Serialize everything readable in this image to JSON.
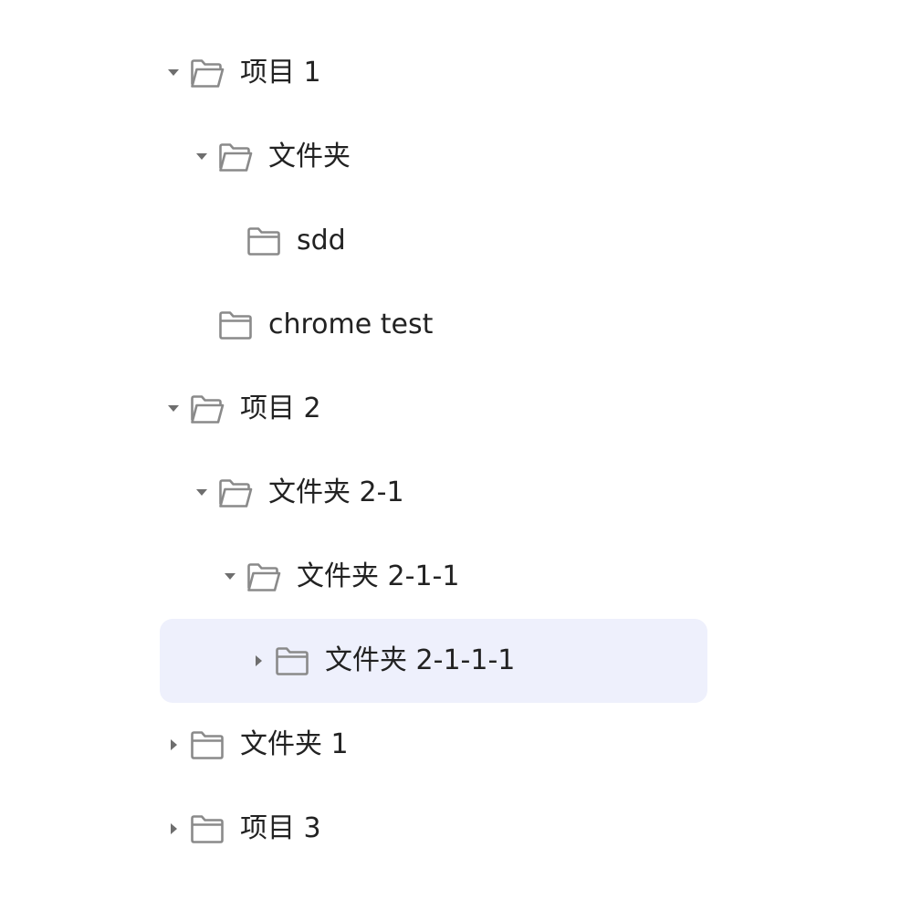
{
  "tree": {
    "nodes": [
      {
        "label": "项目 1",
        "level": 0,
        "expanded": true,
        "has_children": true,
        "selected": false
      },
      {
        "label": "文件夹",
        "level": 1,
        "expanded": true,
        "has_children": true,
        "selected": false
      },
      {
        "label": "sdd",
        "level": 2,
        "expanded": false,
        "has_children": false,
        "selected": false
      },
      {
        "label": "chrome test",
        "level": 1,
        "expanded": false,
        "has_children": false,
        "selected": false
      },
      {
        "label": "项目 2",
        "level": 0,
        "expanded": true,
        "has_children": true,
        "selected": false
      },
      {
        "label": "文件夹 2-1",
        "level": 1,
        "expanded": true,
        "has_children": true,
        "selected": false
      },
      {
        "label": "文件夹 2-1-1",
        "level": 2,
        "expanded": true,
        "has_children": true,
        "selected": false
      },
      {
        "label": "文件夹 2-1-1-1",
        "level": 3,
        "expanded": false,
        "has_children": true,
        "selected": true
      },
      {
        "label": "文件夹 1",
        "level": 0,
        "expanded": false,
        "has_children": true,
        "selected": false
      },
      {
        "label": "项目 3",
        "level": 0,
        "expanded": false,
        "has_children": true,
        "selected": false
      }
    ]
  },
  "colors": {
    "selected_background": "#eef0fc",
    "icon": "#8a8a8a",
    "caret": "#6e6e6e",
    "text": "#222222"
  },
  "icons": {
    "expanded_caret": "caret-down-icon",
    "collapsed_caret": "caret-right-icon",
    "expanded_folder": "folder-open-icon",
    "collapsed_folder": "folder-icon"
  }
}
